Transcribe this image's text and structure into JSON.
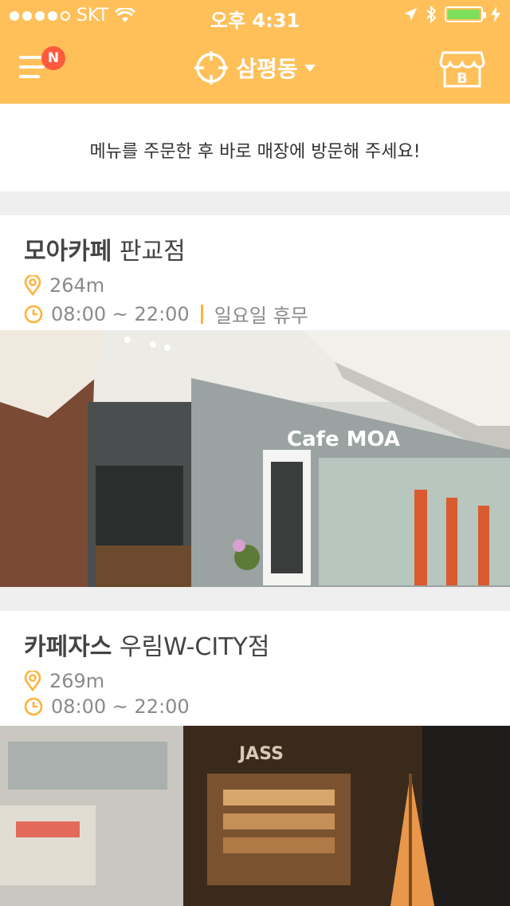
{
  "status": {
    "carrier": "SKT",
    "time": "오후 4:31",
    "icons": [
      "signal-dots",
      "wifi-icon",
      "location-arrow-icon",
      "bluetooth-icon",
      "battery-icon",
      "charging-icon"
    ]
  },
  "nav": {
    "menu_badge": "N",
    "location_label": "삼평동",
    "store_icon_letter": "B"
  },
  "notice": {
    "text": "메뉴를 주문한 후 바로 매장에 방문해 주세요!"
  },
  "stores": [
    {
      "brand": "모아카페",
      "branch": "판교점",
      "distance": "264m",
      "hours": "08:00 ~ 22:00",
      "closed": "일요일 휴무",
      "photo_sign": "Cafe MOA"
    },
    {
      "brand": "카페자스",
      "branch": "우림W-CITY점",
      "distance": "269m",
      "hours": "08:00 ~ 22:00",
      "closed": "",
      "photo_sign": "JASS"
    }
  ],
  "colors": {
    "brand_yellow": "#ffc05a",
    "accent_orange": "#ffb23a",
    "badge_red": "#ff5a3c",
    "battery_green": "#7ee05a"
  }
}
